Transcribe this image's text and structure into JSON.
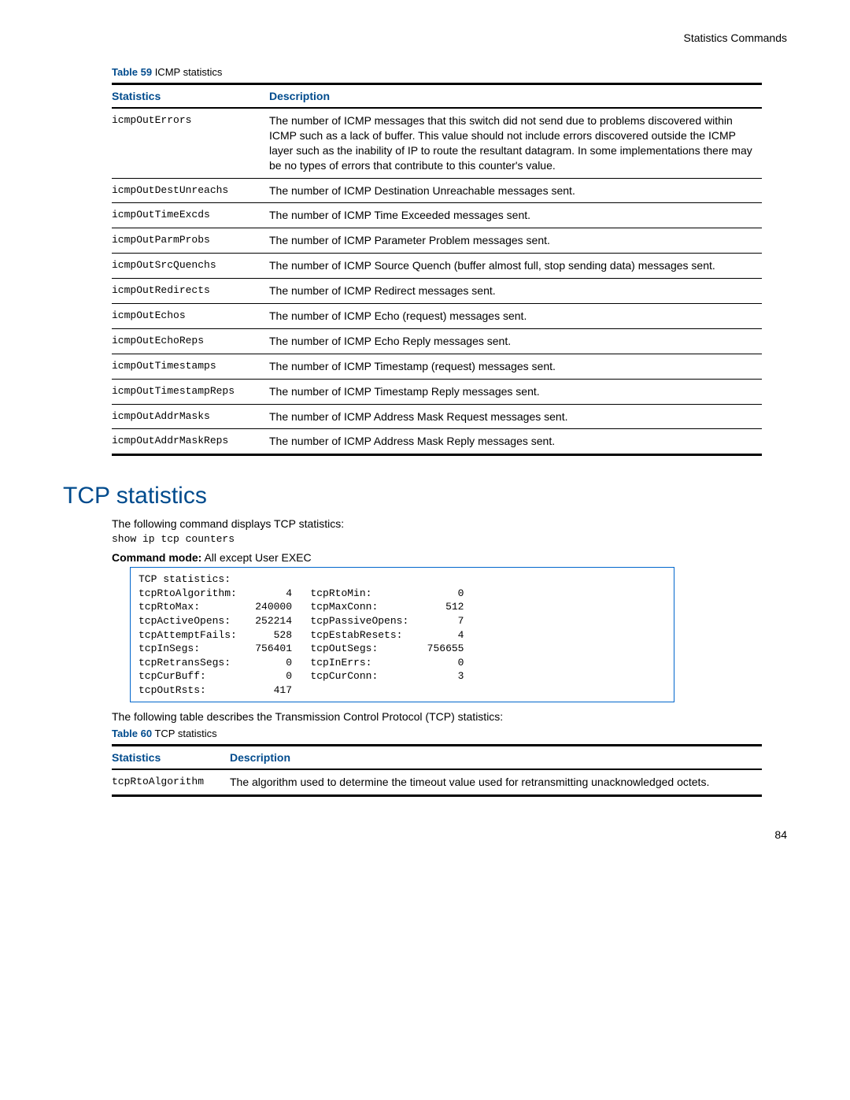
{
  "header": {
    "section": "Statistics Commands"
  },
  "table59": {
    "caption_label": "Table 59",
    "caption_text": "ICMP statistics",
    "cols": {
      "c1": "Statistics",
      "c2": "Description"
    },
    "rows": [
      {
        "stat": "icmpOutErrors",
        "desc": "The number of ICMP messages that this switch did not send due to problems discovered within ICMP such as a lack of buffer. This value should not include errors discovered outside the ICMP layer such as the inability of IP to route the resultant datagram. In some implementations there may be no types of errors that contribute to this counter's value."
      },
      {
        "stat": "icmpOutDestUnreachs",
        "desc": "The number of ICMP Destination Unreachable messages sent."
      },
      {
        "stat": "icmpOutTimeExcds",
        "desc": "The number of ICMP Time Exceeded messages sent."
      },
      {
        "stat": "icmpOutParmProbs",
        "desc": "The number of ICMP Parameter Problem messages sent."
      },
      {
        "stat": "icmpOutSrcQuenchs",
        "desc": "The number of ICMP Source Quench (buffer almost full, stop sending data) messages sent."
      },
      {
        "stat": "icmpOutRedirects",
        "desc": "The number of ICMP Redirect messages sent."
      },
      {
        "stat": "icmpOutEchos",
        "desc": "The number of ICMP Echo (request) messages sent."
      },
      {
        "stat": "icmpOutEchoReps",
        "desc": "The number of ICMP Echo Reply messages sent."
      },
      {
        "stat": "icmpOutTimestamps",
        "desc": "The number of ICMP Timestamp (request) messages sent."
      },
      {
        "stat": "icmpOutTimestampReps",
        "desc": "The number of ICMP Timestamp Reply messages sent."
      },
      {
        "stat": "icmpOutAddrMasks",
        "desc": "The number of ICMP Address Mask Request messages sent."
      },
      {
        "stat": "icmpOutAddrMaskReps",
        "desc": "The number of ICMP Address Mask Reply messages sent."
      }
    ]
  },
  "section2": {
    "heading": "TCP statistics",
    "intro": "The following command displays TCP statistics:",
    "command": "show ip tcp counters",
    "mode_label": "Command mode:",
    "mode_text": " All except User EXEC",
    "console": "TCP statistics:\ntcpRtoAlgorithm:        4   tcpRtoMin:              0\ntcpRtoMax:         240000   tcpMaxConn:           512\ntcpActiveOpens:    252214   tcpPassiveOpens:        7\ntcpAttemptFails:      528   tcpEstabResets:         4\ntcpInSegs:         756401   tcpOutSegs:        756655\ntcpRetransSegs:         0   tcpInErrs:              0\ntcpCurBuff:             0   tcpCurConn:             3\ntcpOutRsts:           417",
    "after_console": "The following table describes the Transmission Control Protocol (TCP) statistics:"
  },
  "table60": {
    "caption_label": "Table 60",
    "caption_text": "TCP statistics",
    "cols": {
      "c1": "Statistics",
      "c2": "Description"
    },
    "rows": [
      {
        "stat": "tcpRtoAlgorithm",
        "desc": "The algorithm used to determine the timeout value used for retransmitting unacknowledged octets."
      }
    ]
  },
  "page": {
    "number": "84"
  }
}
